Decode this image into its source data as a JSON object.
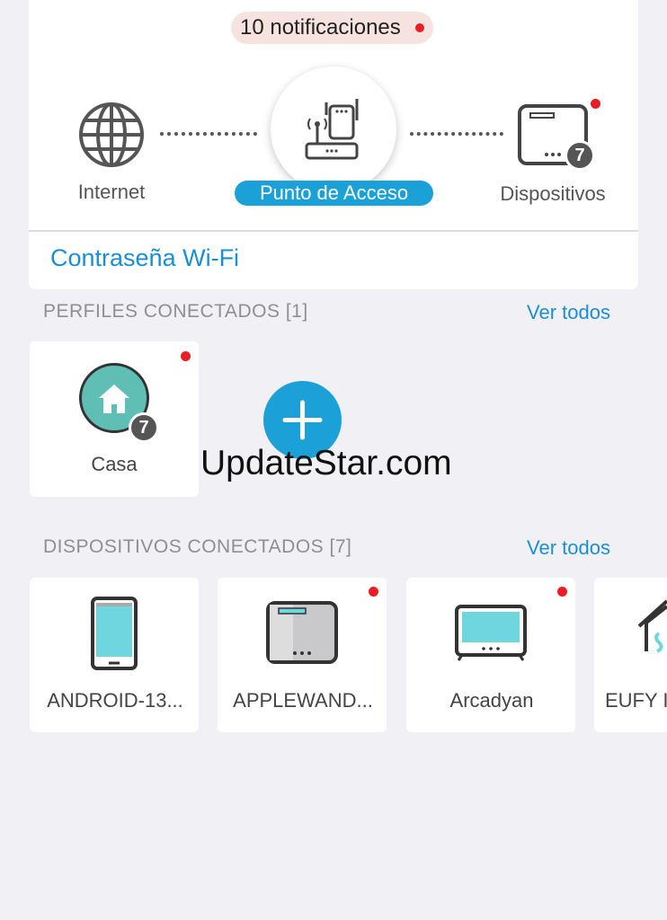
{
  "notifications": {
    "label": "10 notificaciones"
  },
  "topology": {
    "internet_label": "Internet",
    "access_point_label": "Punto de Acceso",
    "devices_label": "Dispositivos",
    "devices_count": "7"
  },
  "wifi_password_link": "Contraseña Wi-Fi",
  "profiles": {
    "section_title": "PERFILES CONECTADOS [1]",
    "see_all": "Ver todos",
    "items": [
      {
        "name": "Casa",
        "count": "7"
      }
    ]
  },
  "watermark": "UpdateStar.com",
  "devices": {
    "section_title": "DISPOSITIVOS CONECTADOS [7]",
    "see_all": "Ver todos",
    "items": [
      {
        "name": "ANDROID-13...",
        "icon": "phone-icon"
      },
      {
        "name": "APPLEWAND...",
        "icon": "router-box-icon"
      },
      {
        "name": "Arcadyan",
        "icon": "tv-icon"
      },
      {
        "name": "EUFY I",
        "icon": "smart-home-icon"
      }
    ]
  },
  "colors": {
    "accent": "#1ba1d8",
    "link": "#1a8fd6",
    "alert": "#ec1c24",
    "teal": "#5fbfb5",
    "device_screen": "#6fd6e0"
  }
}
